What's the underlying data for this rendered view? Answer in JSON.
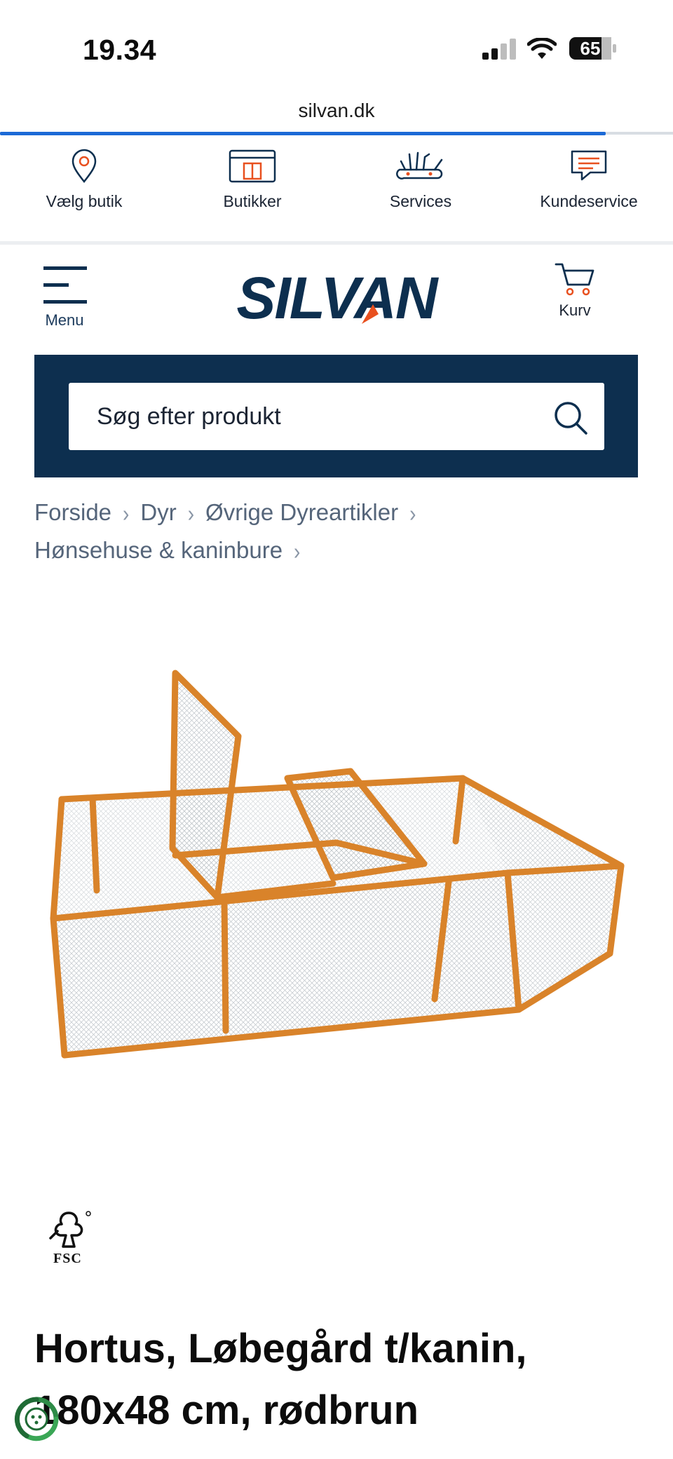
{
  "status_bar": {
    "time": "19.34",
    "battery_level": "65"
  },
  "browser": {
    "url": "silvan.dk",
    "load_progress": 0.9
  },
  "utility_nav": [
    {
      "label": "Vælg butik",
      "icon": "map-pin-icon"
    },
    {
      "label": "Butikker",
      "icon": "store-icon"
    },
    {
      "label": "Services",
      "icon": "tools-icon"
    },
    {
      "label": "Kundeservice",
      "icon": "chat-icon"
    }
  ],
  "header": {
    "menu_label": "Menu",
    "logo_text": "SILVAN",
    "cart_label": "Kurv"
  },
  "search": {
    "placeholder": "Søg efter produkt"
  },
  "breadcrumb": [
    "Forside",
    "Dyr",
    "Øvrige Dyreartikler",
    "Hønsehuse & kaninbure"
  ],
  "product": {
    "certification": "FSC",
    "title": "Hortus, Løbegård t/kanin, 180x48 cm, rødbrun"
  },
  "colors": {
    "brand_navy": "#0d2f4f",
    "brand_orange": "#e8501f",
    "progress_blue": "#1c6ad6"
  }
}
